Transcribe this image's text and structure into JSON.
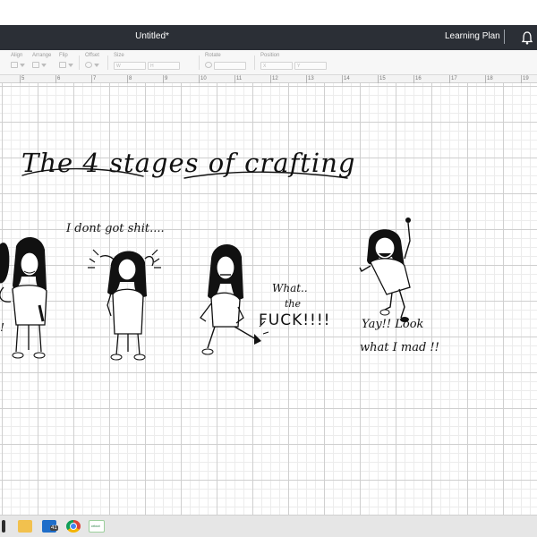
{
  "window": {
    "title": "Untitled*",
    "learning_plan": "Learning Plan",
    "divider": "|"
  },
  "toolbar": {
    "align": "Align",
    "arrange": "Arrange",
    "flip": "Flip",
    "offset": "Offset",
    "size": "Size",
    "rotate": "Rotate",
    "position": "Position",
    "w": "W",
    "h": "H",
    "x": "X",
    "y": "Y"
  },
  "ruler": {
    "numbers": [
      "5",
      "6",
      "7",
      "8",
      "9",
      "10",
      "11",
      "12",
      "13",
      "14",
      "15",
      "16",
      "17",
      "18",
      "19"
    ]
  },
  "canvas": {
    "headline": "The 4 stages of crafting",
    "caption_stage1_partial": "s!",
    "caption_stage2": "I dont got shit....",
    "caption_stage3_line1": "What..",
    "caption_stage3_line2": "the",
    "caption_stage3_line3": "FUCK!!!!",
    "caption_stage4_line1": "Yay!! Look",
    "caption_stage4_line2": "what I mad !!"
  },
  "taskbar": {
    "icons": [
      "windows-icon",
      "file-explorer-icon",
      "outlook-icon",
      "chrome-icon",
      "cricut-icon"
    ],
    "badge": "41",
    "cricut_label": "cricut"
  },
  "colors": {
    "titlebar": "#2b2f36",
    "grid": "#cfcfcf",
    "chrome_red": "#db4437",
    "folder_yellow": "#f2c14e"
  }
}
